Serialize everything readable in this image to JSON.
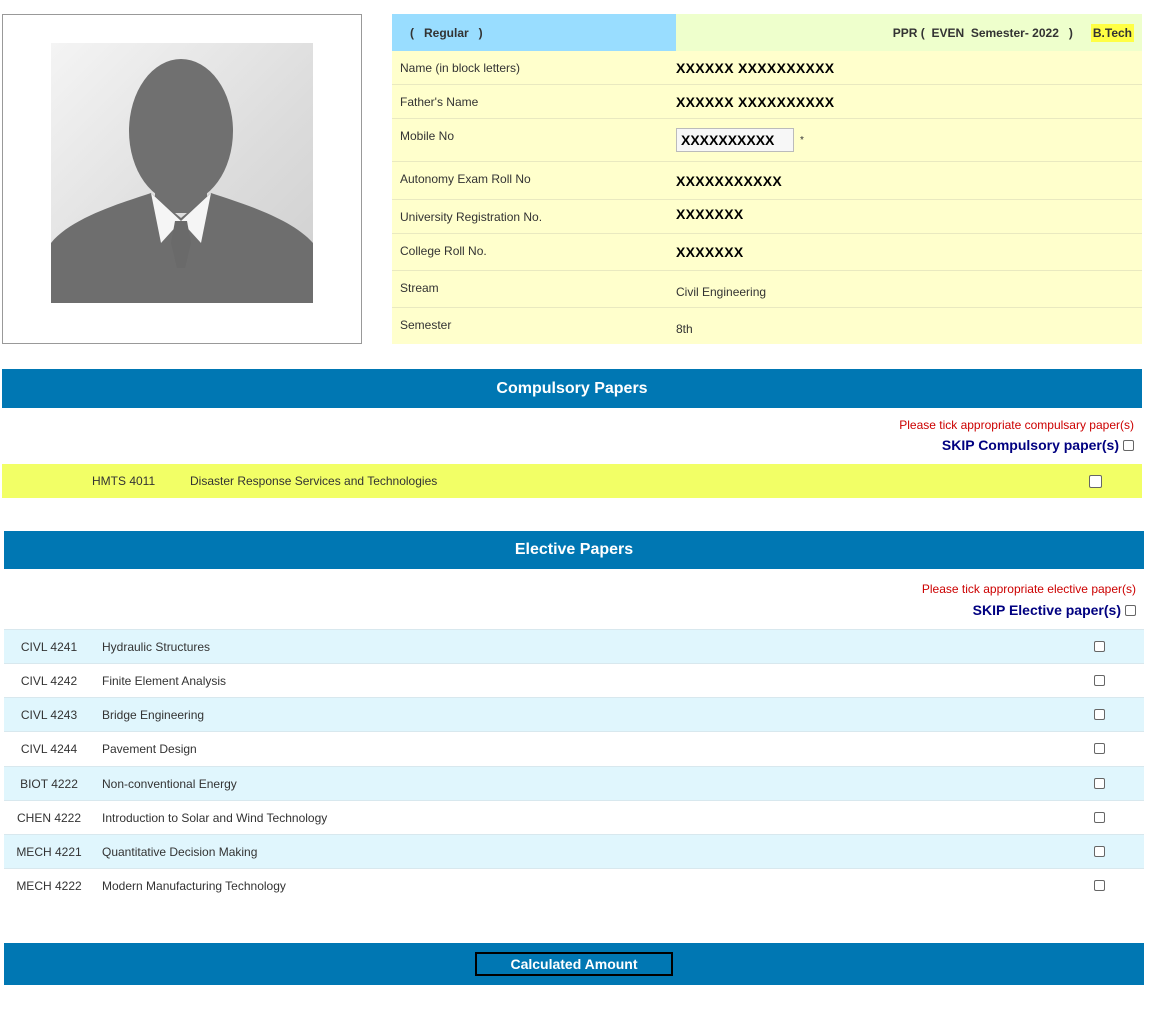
{
  "header": {
    "type_label": "(   Regular   )",
    "exam_label": "PPR (  EVEN  Semester- 2022   )",
    "degree_badge": "B.Tech"
  },
  "profile": {
    "fields": [
      {
        "label": "Name (in block letters)",
        "value": "XXXXXX XXXXXXXXXX"
      },
      {
        "label": "Father's Name",
        "value": "XXXXXX XXXXXXXXXX"
      },
      {
        "label": "Mobile No",
        "value": "XXXXXXXXXX",
        "required_mark": "*"
      },
      {
        "label": "Autonomy Exam Roll No",
        "value": "XXXXXXXXXXX"
      },
      {
        "label": "University Registration No.",
        "value": "XXXXXXX"
      },
      {
        "label": "College Roll No.",
        "value": "XXXXXXX"
      },
      {
        "label": "Stream",
        "value": "Civil Engineering"
      },
      {
        "label": "Semester",
        "value": "8th"
      }
    ]
  },
  "compulsory": {
    "title": "Compulsory Papers",
    "note": "Please tick appropriate compulsary paper(s)",
    "skip_label": "SKIP Compulsory paper(s)",
    "papers": [
      {
        "code": "HMTS 4011",
        "name": "Disaster Response Services and Technologies"
      }
    ]
  },
  "elective": {
    "title": "Elective Papers",
    "note": "Please tick appropriate elective paper(s)",
    "skip_label": "SKIP Elective paper(s)",
    "papers": [
      {
        "code": "CIVL 4241",
        "name": "Hydraulic Structures"
      },
      {
        "code": "CIVL 4242",
        "name": "Finite Element Analysis"
      },
      {
        "code": "CIVL 4243",
        "name": "Bridge Engineering"
      },
      {
        "code": "CIVL 4244",
        "name": "Pavement Design"
      },
      {
        "code": "BIOT 4222",
        "name": "Non-conventional Energy"
      },
      {
        "code": "CHEN 4222",
        "name": "Introduction to Solar and Wind Technology"
      },
      {
        "code": "MECH 4221",
        "name": "Quantitative Decision Making"
      },
      {
        "code": "MECH 4222",
        "name": "Modern Manufacturing Technology"
      }
    ]
  },
  "footer": {
    "calc_button": "Calculated Amount"
  },
  "colors": {
    "section_bar": "#0077b3",
    "header_left": "#99ddff",
    "info_row": "#ffffcc",
    "compulsory_row": "#f2ff66",
    "elective_alt_row": "#e0f6fd",
    "note_red": "#cc0000",
    "skip_navy": "#000080"
  },
  "icons": {
    "photo": "person-silhouette-icon"
  }
}
